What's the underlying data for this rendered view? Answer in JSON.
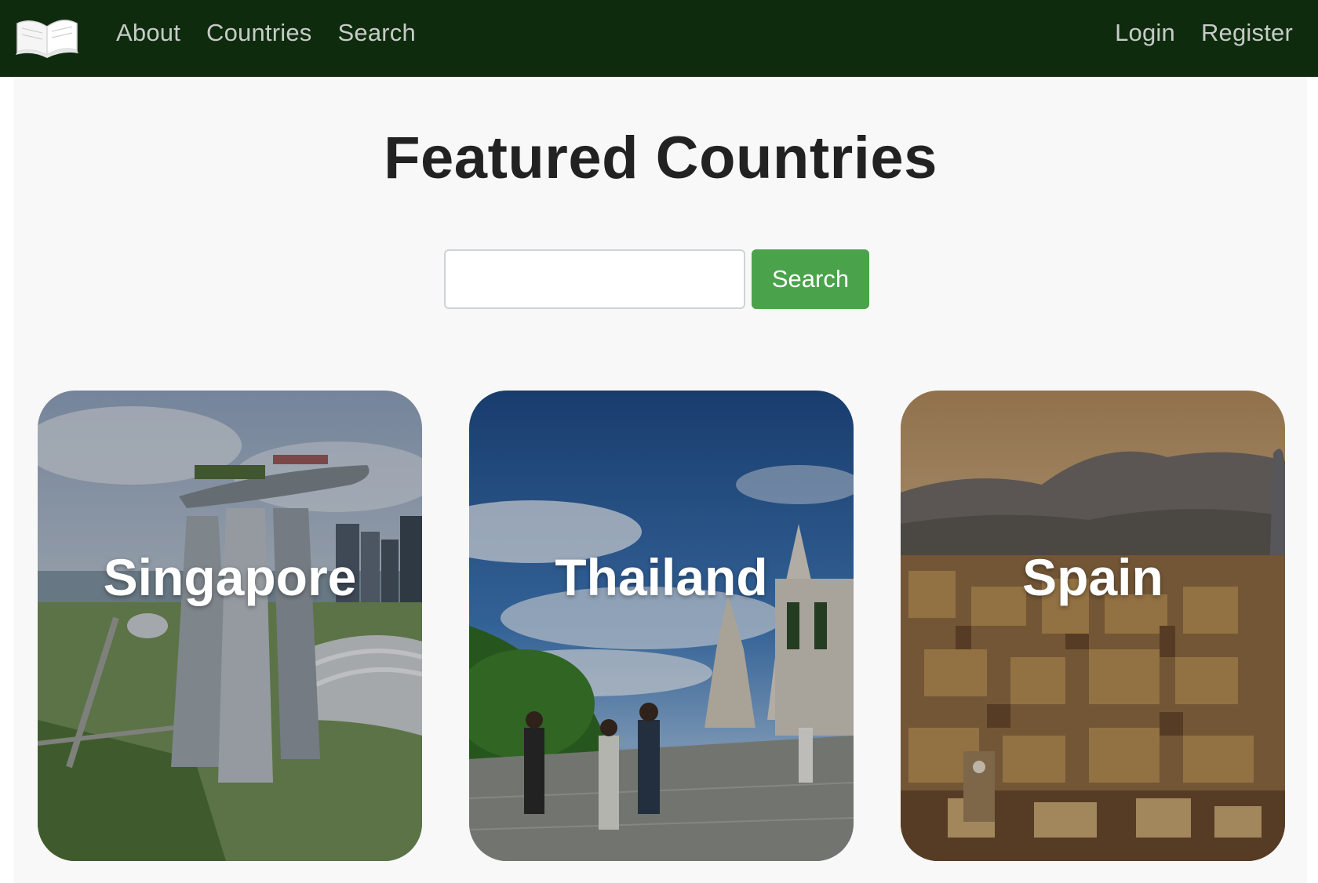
{
  "nav": {
    "brand_icon": "open-book-icon",
    "links_left": [
      "About",
      "Countries",
      "Search"
    ],
    "links_right": [
      "Login",
      "Register"
    ]
  },
  "main": {
    "title": "Featured Countries",
    "search": {
      "value": "",
      "placeholder": "",
      "button_label": "Search"
    },
    "cards": [
      {
        "name": "Singapore"
      },
      {
        "name": "Thailand"
      },
      {
        "name": "Spain"
      }
    ]
  },
  "colors": {
    "navbar_bg": "#0f2b0e",
    "nav_link": "#c6cbc6",
    "page_bg": "#f8f8f8",
    "search_button": "#4aa34a",
    "title_text": "#222222"
  }
}
